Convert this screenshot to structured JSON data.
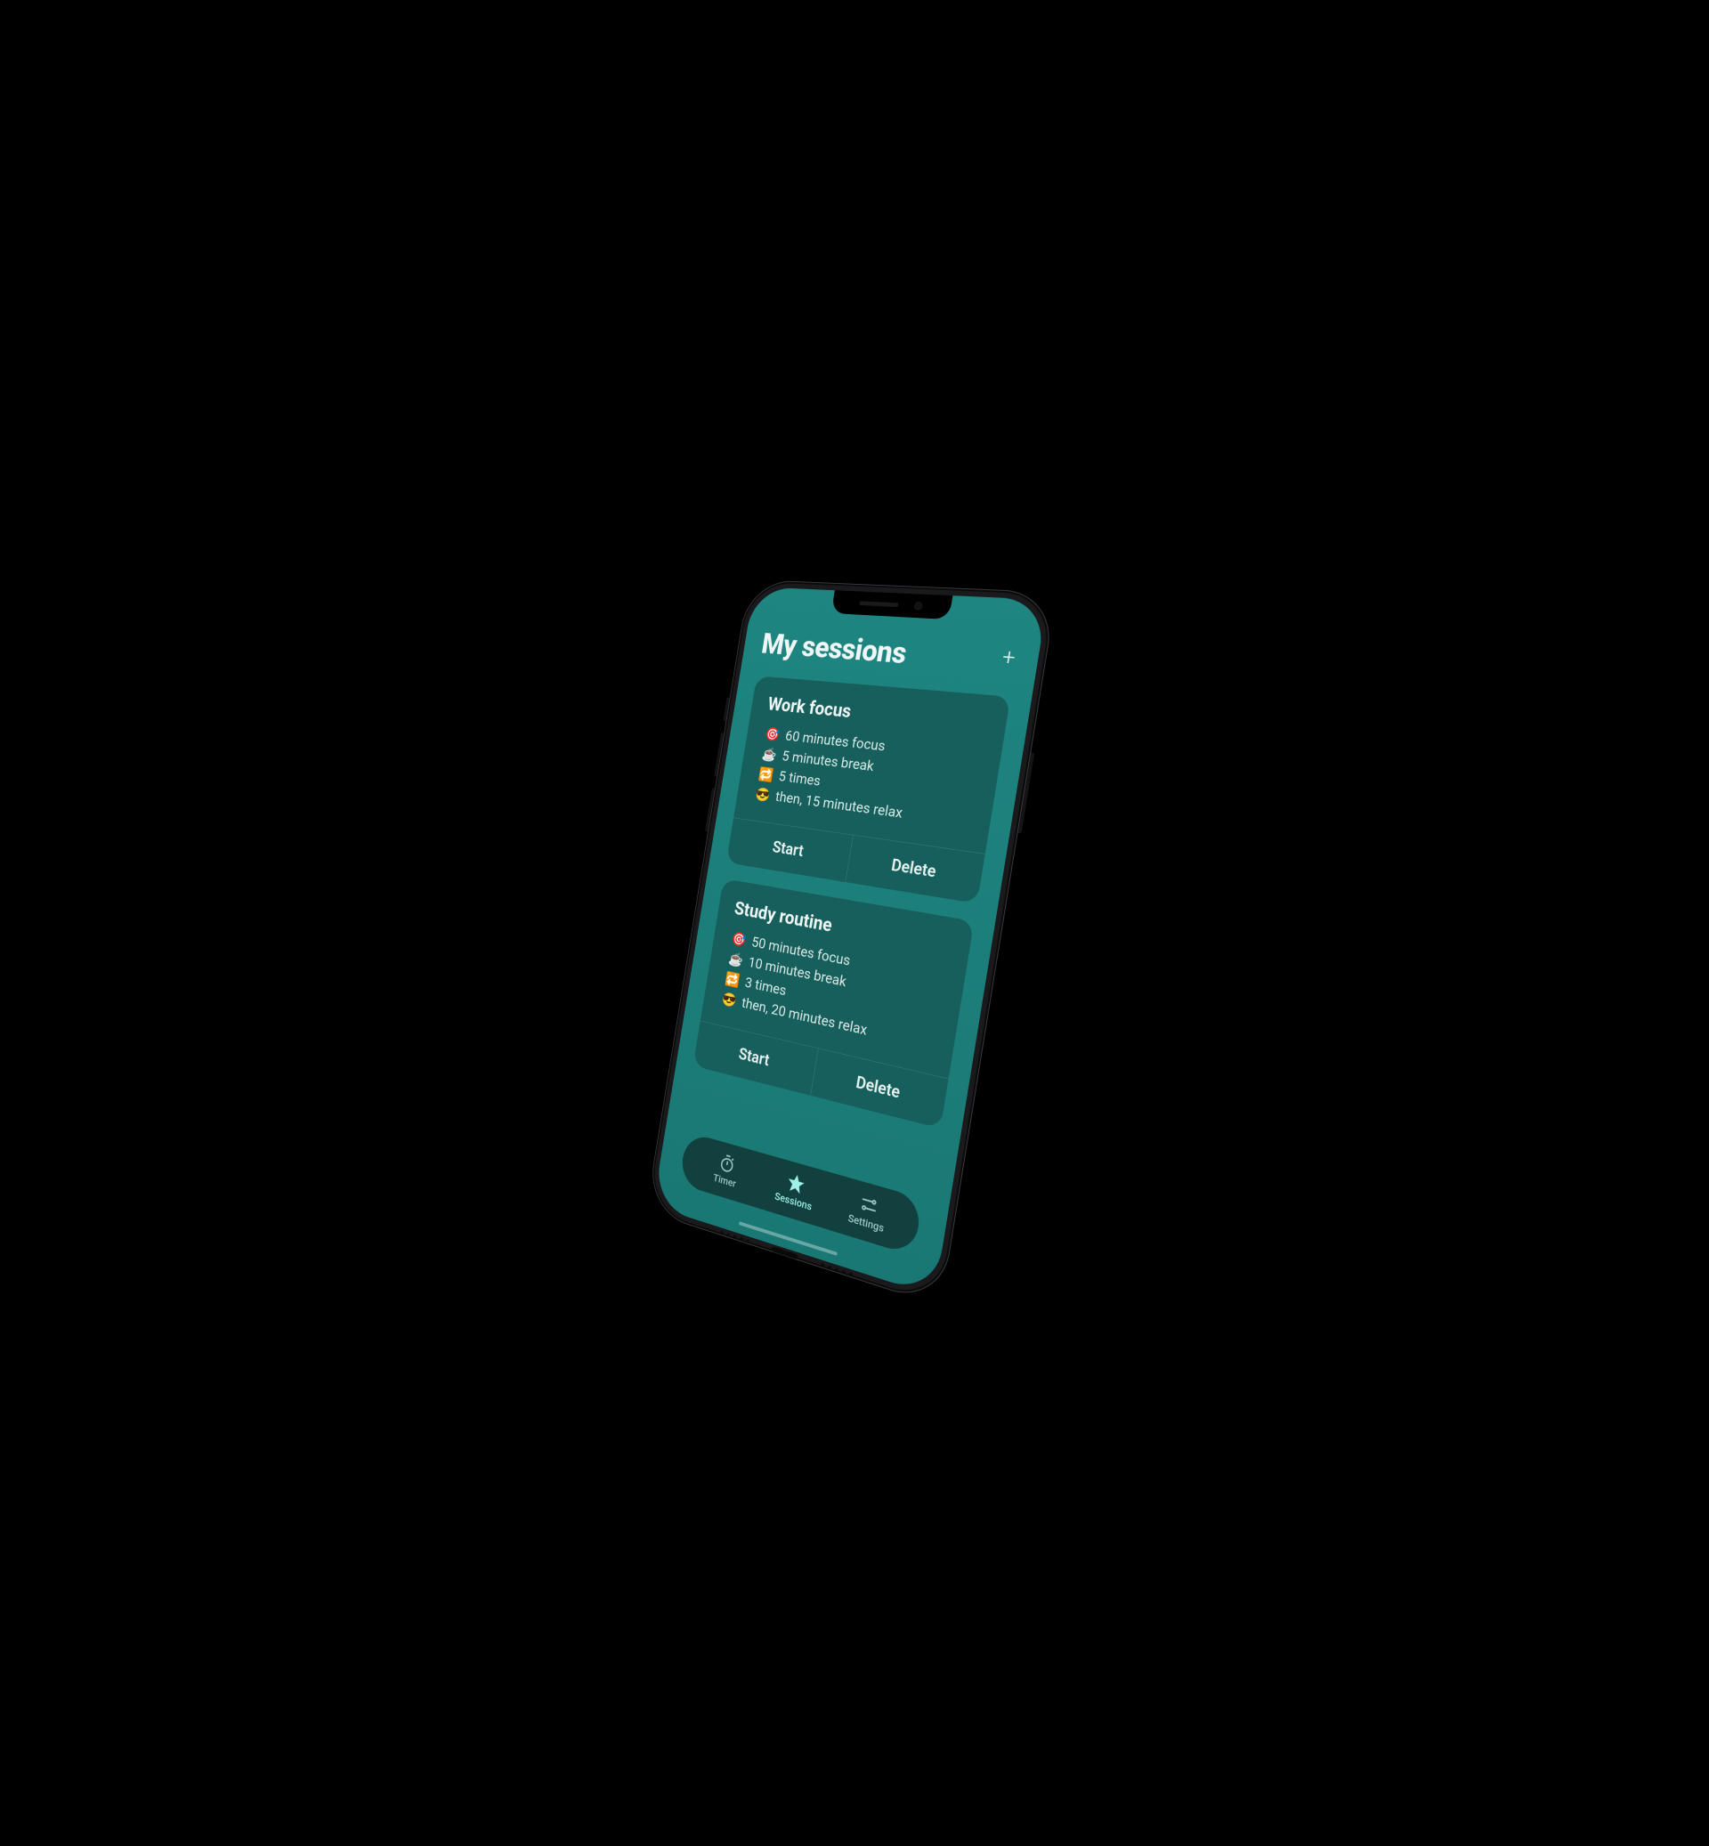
{
  "header": {
    "title": "My sessions",
    "add_icon": "+"
  },
  "icons": {
    "target": "🎯",
    "coffee": "☕",
    "repeat": "🔁",
    "cool": "😎"
  },
  "actions": {
    "start": "Start",
    "delete": "Delete"
  },
  "sessions": [
    {
      "title": "Work focus",
      "focus": "60 minutes focus",
      "break": "5 minutes break",
      "repeat": "5 times",
      "relax": "then, 15 minutes relax"
    },
    {
      "title": "Study routine",
      "focus": "50 minutes focus",
      "break": "10 minutes break",
      "repeat": "3 times",
      "relax": "then, 20 minutes relax"
    }
  ],
  "nav": {
    "timer": "Timer",
    "sessions": "Sessions",
    "settings": "Settings"
  }
}
